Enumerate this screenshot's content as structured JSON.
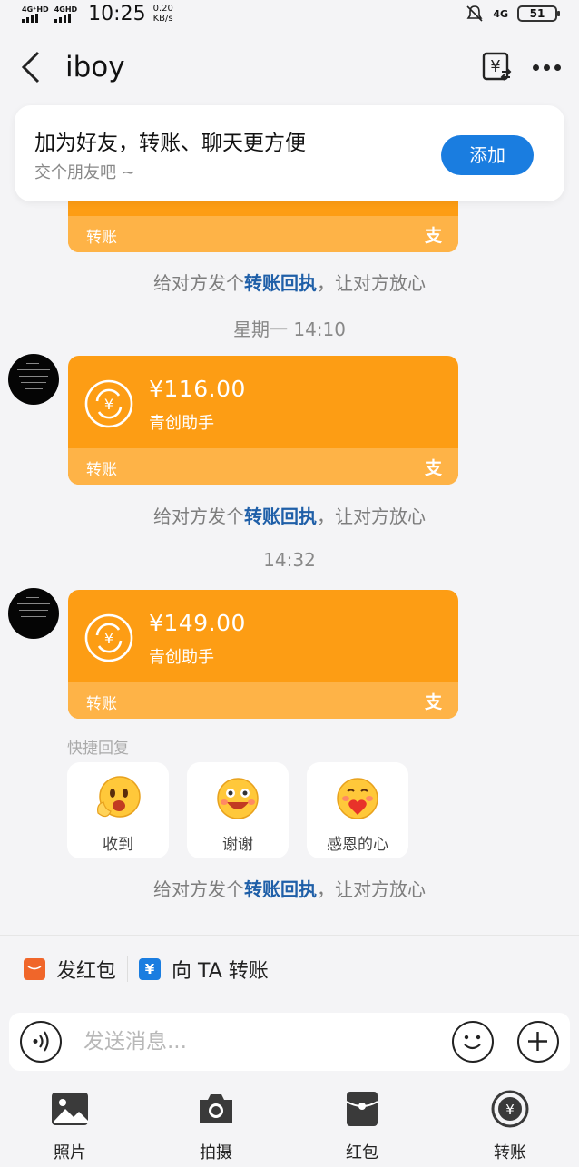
{
  "status_bar": {
    "net1": "4G⁺HD",
    "net2": "4GHD",
    "time": "10:25",
    "speed_value": "0.20",
    "speed_unit": "KB/s",
    "net3": "4G",
    "battery": "51"
  },
  "nav": {
    "title": "iboy"
  },
  "friend_banner": {
    "title": "加为好友，转账、聊天更方便",
    "subtitle": "交个朋友吧 ~",
    "button": "添加"
  },
  "messages": [
    {
      "type": "transfer",
      "amount": "",
      "payer": "",
      "label": "转账",
      "logo": "支"
    },
    {
      "type": "transfer",
      "amount": "¥116.00",
      "payer": "青创助手",
      "label": "转账",
      "logo": "支"
    },
    {
      "type": "transfer",
      "amount": "¥149.00",
      "payer": "青创助手",
      "label": "转账",
      "logo": "支"
    }
  ],
  "receipt_hint": {
    "before": "给对方发个",
    "link": "转账回执",
    "after": "，让对方放心"
  },
  "time_separators": [
    "星期一 14:10",
    "14:32"
  ],
  "quick_reply": {
    "title": "快捷回复",
    "items": [
      {
        "label": "收到",
        "icon": "ok-emoji-icon"
      },
      {
        "label": "谢谢",
        "icon": "laugh-emoji-icon"
      },
      {
        "label": "感恩的心",
        "icon": "heart-emoji-icon"
      }
    ]
  },
  "actions": {
    "red_packet": "发红包",
    "transfer_to": "向 TA 转账"
  },
  "input": {
    "placeholder": "发送消息..."
  },
  "toolbar": {
    "photo": "照片",
    "camera": "拍摄",
    "red_packet": "红包",
    "transfer": "转账"
  },
  "colors": {
    "transfer_orange": "#fd9d14",
    "transfer_footer": "#feb347",
    "accent_blue": "#1a7de0",
    "link_blue": "#1f5fa8"
  }
}
